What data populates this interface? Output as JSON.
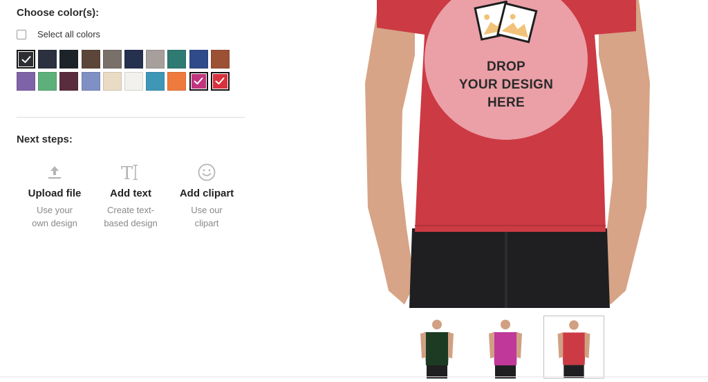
{
  "colors_section": {
    "heading": "Choose color(s):",
    "select_all_label": "Select all colors",
    "swatches": [
      {
        "color": "#2d2e33",
        "selected": true
      },
      {
        "color": "#2c3140",
        "selected": false
      },
      {
        "color": "#1c2329",
        "selected": false
      },
      {
        "color": "#5c4639",
        "selected": false
      },
      {
        "color": "#7a706a",
        "selected": false
      },
      {
        "color": "#26304f",
        "selected": false
      },
      {
        "color": "#a79f9b",
        "selected": false
      },
      {
        "color": "#2f7a72",
        "selected": false
      },
      {
        "color": "#2f4b8a",
        "selected": false
      },
      {
        "color": "#9c5034",
        "selected": false
      },
      {
        "color": "#7f63a8",
        "selected": false
      },
      {
        "color": "#5eb07a",
        "selected": false
      },
      {
        "color": "#5a2d3e",
        "selected": false
      },
      {
        "color": "#7f90c4",
        "selected": false
      },
      {
        "color": "#eadcc4",
        "selected": false
      },
      {
        "color": "#f3f1ed",
        "selected": false
      },
      {
        "color": "#3f97b8",
        "selected": false
      },
      {
        "color": "#ef7a3e",
        "selected": false
      },
      {
        "color": "#c0357e",
        "selected": true
      },
      {
        "color": "#d9313d",
        "selected": true
      }
    ]
  },
  "next_steps": {
    "heading": "Next steps:",
    "items": [
      {
        "icon": "upload-icon",
        "title": "Upload file",
        "desc_line1": "Use your",
        "desc_line2": "own design"
      },
      {
        "icon": "text-icon",
        "title": "Add text",
        "desc_line1": "Create text-",
        "desc_line2": "based design"
      },
      {
        "icon": "smiley-icon",
        "title": "Add clipart",
        "desc_line1": "Use our",
        "desc_line2": "clipart"
      }
    ]
  },
  "preview": {
    "drop_line1": "DROP",
    "drop_line2": "YOUR DESIGN",
    "drop_line3": "HERE",
    "shirt_color": "#cc3a44",
    "circle_color": "#f0b2b8"
  },
  "thumbnails": [
    {
      "color": "#1d3b22",
      "active": false
    },
    {
      "color": "#c0389a",
      "active": false
    },
    {
      "color": "#cc3a44",
      "active": true
    }
  ]
}
